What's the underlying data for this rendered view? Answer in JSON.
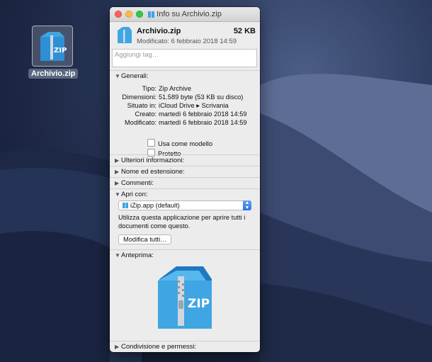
{
  "desktop": {
    "icon_label": "Archivio.zip",
    "icon_name": "zip-archive-icon"
  },
  "window": {
    "title": "Info su Archivio.zip",
    "file_name": "Archivio.zip",
    "file_size": "52 KB",
    "modified_line": "Modificato: 6 febbraio 2018 14:59",
    "tags_placeholder": "Aggiungi tag…"
  },
  "general": {
    "header": "Generali:",
    "rows": [
      {
        "label": "Tipo:",
        "value": "Zip Archive"
      },
      {
        "label": "Dimensioni:",
        "value": "51.589 byte (53 KB su disco)"
      },
      {
        "label": "Situato in:",
        "value": "iCloud Drive ▸ Scrivania"
      },
      {
        "label": "Creato:",
        "value": "martedì 6 febbraio 2018 14:59"
      },
      {
        "label": "Modificato:",
        "value": "martedì 6 febbraio 2018 14:59"
      }
    ],
    "checkbox_template": "Usa come modello",
    "checkbox_locked": "Protetto"
  },
  "sections": {
    "more_info": "Ulteriori informazioni:",
    "name_ext": "Nome ed estensione:",
    "comments": "Commenti:",
    "open_with": "Apri con:",
    "preview": "Anteprima:",
    "sharing": "Condivisione e permessi:"
  },
  "open_with": {
    "app": "iZip.app (default)",
    "description": "Utilizza questa applicazione per aprire tutti i documenti come questo.",
    "change_all": "Modifica tutti…"
  },
  "preview_icon": {
    "text": "ZIP"
  },
  "colors": {
    "folder_blue": "#3fa5e3",
    "folder_dark": "#1f78c0",
    "select_blue": "#2a74e6"
  }
}
